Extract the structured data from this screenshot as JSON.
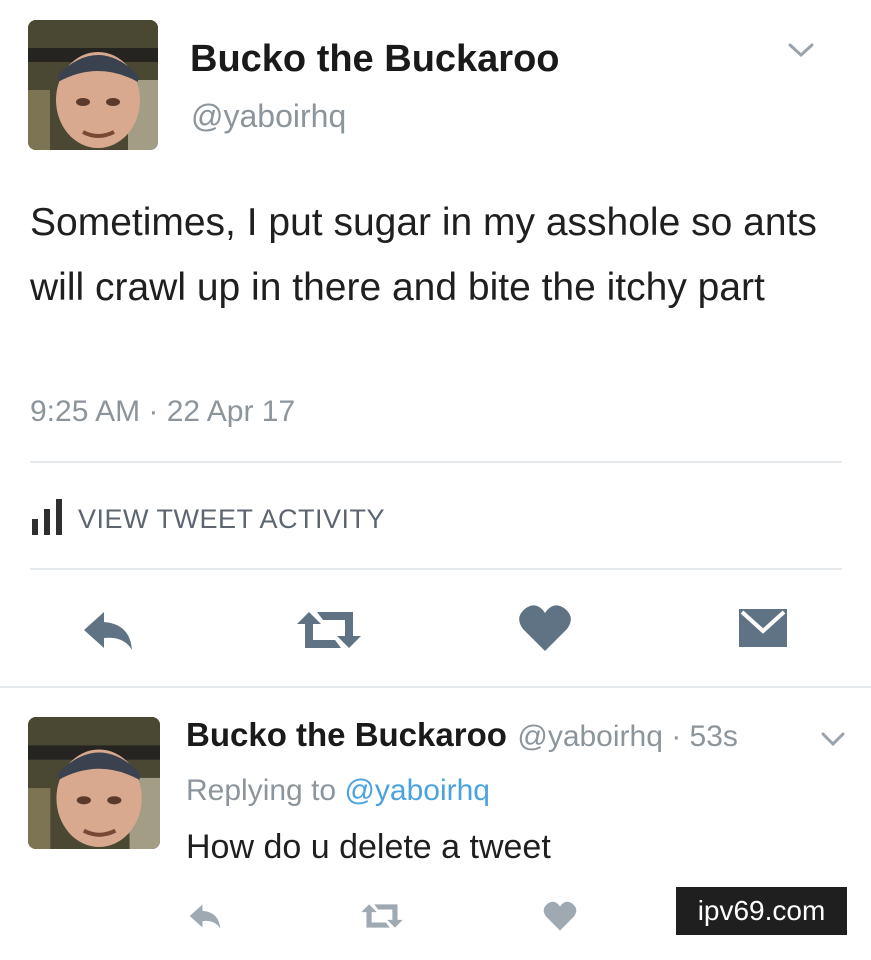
{
  "tweet": {
    "display_name": "Bucko the Buckaroo",
    "handle": "@yaboirhq",
    "text": "Sometimes, I put sugar in my asshole so ants will crawl up in there and bite the itchy part",
    "timestamp": "9:25 AM · 22 Apr 17",
    "activity_label": "VIEW TWEET ACTIVITY",
    "icons": {
      "menu": "chevron-down-icon",
      "activity": "bar-chart-icon",
      "reply": "reply-icon",
      "retweet": "retweet-icon",
      "like": "heart-icon",
      "dm": "envelope-icon"
    }
  },
  "reply": {
    "display_name": "Bucko the Buckaroo",
    "meta": "@yaboirhq · 53s",
    "replying_prefix": "Replying to",
    "replying_handle": "@yaboirhq",
    "text": "How do u delete a tweet"
  },
  "watermark": "ipv69.com",
  "colors": {
    "text": "#1c1c1c",
    "muted": "#8d959c",
    "icon": "#5f7384",
    "link": "#4aa3df",
    "activity_bar": "#2f2f2f"
  }
}
